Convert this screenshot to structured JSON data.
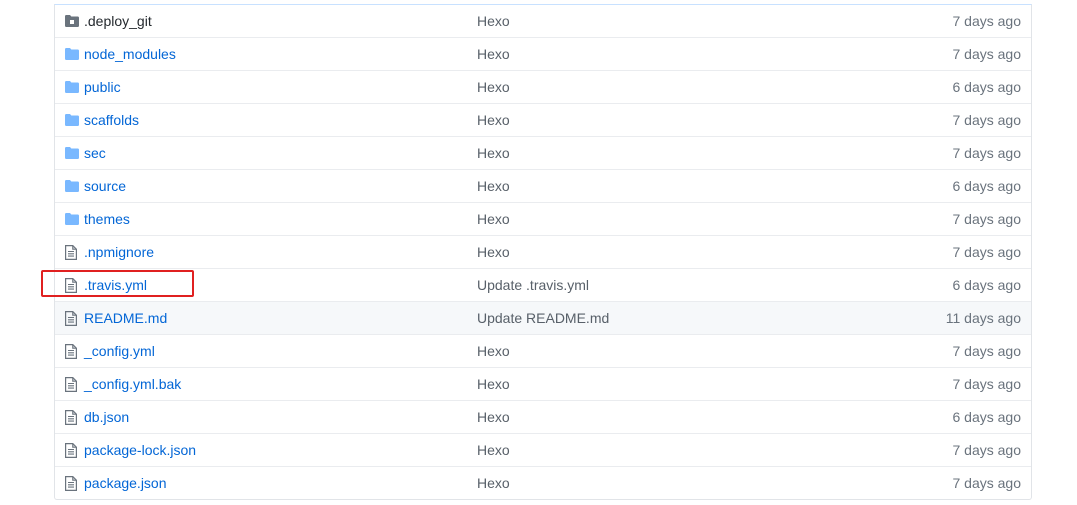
{
  "files": [
    {
      "name": "deploy-git",
      "label": ".deploy_git",
      "type": "submodule",
      "message": "Hexo",
      "age": "7 days ago"
    },
    {
      "name": "node-modules",
      "label": "node_modules",
      "type": "folder",
      "message": "Hexo",
      "age": "7 days ago"
    },
    {
      "name": "public",
      "label": "public",
      "type": "folder",
      "message": "Hexo",
      "age": "6 days ago"
    },
    {
      "name": "scaffolds",
      "label": "scaffolds",
      "type": "folder",
      "message": "Hexo",
      "age": "7 days ago"
    },
    {
      "name": "sec",
      "label": "sec",
      "type": "folder",
      "message": "Hexo",
      "age": "7 days ago"
    },
    {
      "name": "source",
      "label": "source",
      "type": "folder",
      "message": "Hexo",
      "age": "6 days ago"
    },
    {
      "name": "themes",
      "label": "themes",
      "type": "folder",
      "message": "Hexo",
      "age": "7 days ago"
    },
    {
      "name": "npmignore",
      "label": ".npmignore",
      "type": "file",
      "message": "Hexo",
      "age": "7 days ago"
    },
    {
      "name": "travis-yml",
      "label": ".travis.yml",
      "type": "file",
      "message": "Update .travis.yml",
      "age": "6 days ago"
    },
    {
      "name": "readme-md",
      "label": "README.md",
      "type": "file",
      "message": "Update README.md",
      "age": "11 days ago"
    },
    {
      "name": "config-yml",
      "label": "_config.yml",
      "type": "file",
      "message": "Hexo",
      "age": "7 days ago"
    },
    {
      "name": "config-yml-bak",
      "label": "_config.yml.bak",
      "type": "file",
      "message": "Hexo",
      "age": "7 days ago"
    },
    {
      "name": "db-json",
      "label": "db.json",
      "type": "file",
      "message": "Hexo",
      "age": "6 days ago"
    },
    {
      "name": "package-lock-json",
      "label": "package-lock.json",
      "type": "file",
      "message": "Hexo",
      "age": "7 days ago"
    },
    {
      "name": "package-json",
      "label": "package.json",
      "type": "file",
      "message": "Hexo",
      "age": "7 days ago"
    }
  ],
  "colors": {
    "link": "#0366d6",
    "folder_icon": "#79b8ff",
    "file_icon": "#6a737d",
    "highlight_box": "#e02020",
    "hover_row": "#f6f8fa"
  }
}
